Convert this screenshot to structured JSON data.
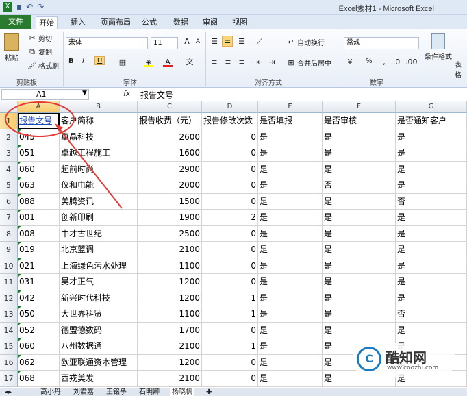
{
  "window": {
    "title": "Excel素材1 - Microsoft Excel"
  },
  "ribbon_tabs": [
    "文件",
    "开始",
    "插入",
    "页面布局",
    "公式",
    "数据",
    "审阅",
    "视图"
  ],
  "clipboard": {
    "paste": "粘贴",
    "cut": "剪切",
    "copy": "复制",
    "format_painter": "格式刷",
    "label": "剪贴板"
  },
  "font": {
    "name": "宋体",
    "size": "11",
    "label": "字体",
    "bold": "B",
    "italic": "I",
    "underline": "U"
  },
  "alignment": {
    "wrap": "自动换行",
    "merge": "合并后居中",
    "label": "对齐方式"
  },
  "number": {
    "format": "常规",
    "percent": "%",
    "label": "数字"
  },
  "styles": {
    "conditional": "条件格式",
    "table": "表格"
  },
  "name_box": "A1",
  "formula_value": "报告文号",
  "fx": "fx",
  "columns": [
    "A",
    "B",
    "C",
    "D",
    "E",
    "F",
    "G"
  ],
  "headers": [
    "报告文号",
    "客户简称",
    "报告收费（元）",
    "报告修改次数",
    "是否填报",
    "是否审核",
    "是否通知客户"
  ],
  "rows": [
    {
      "n": "1"
    },
    {
      "n": "2",
      "a": "045",
      "b": "卓晶科技",
      "c": "2600",
      "d": "0",
      "e": "是",
      "f": "是",
      "g": "是"
    },
    {
      "n": "3",
      "a": "051",
      "b": "卓越工程施工",
      "c": "1600",
      "d": "0",
      "e": "是",
      "f": "是",
      "g": "是"
    },
    {
      "n": "4",
      "a": "060",
      "b": "超前时尚",
      "c": "2900",
      "d": "0",
      "e": "是",
      "f": "是",
      "g": "是"
    },
    {
      "n": "5",
      "a": "063",
      "b": "仪和电能",
      "c": "2000",
      "d": "0",
      "e": "是",
      "f": "否",
      "g": "是"
    },
    {
      "n": "6",
      "a": "088",
      "b": "美腾资讯",
      "c": "1500",
      "d": "0",
      "e": "是",
      "f": "是",
      "g": "否"
    },
    {
      "n": "7",
      "a": "001",
      "b": "创新印刷",
      "c": "1900",
      "d": "2",
      "e": "是",
      "f": "是",
      "g": "是"
    },
    {
      "n": "8",
      "a": "008",
      "b": "中才古世纪",
      "c": "2500",
      "d": "0",
      "e": "是",
      "f": "是",
      "g": "是"
    },
    {
      "n": "9",
      "a": "019",
      "b": "北京蓝调",
      "c": "2100",
      "d": "0",
      "e": "是",
      "f": "是",
      "g": "是"
    },
    {
      "n": "10",
      "a": "021",
      "b": "上海绿色污水处理",
      "c": "1100",
      "d": "0",
      "e": "是",
      "f": "是",
      "g": "是"
    },
    {
      "n": "11",
      "a": "031",
      "b": "昊才正气",
      "c": "1200",
      "d": "0",
      "e": "是",
      "f": "是",
      "g": "是"
    },
    {
      "n": "12",
      "a": "042",
      "b": "新兴时代科技",
      "c": "1200",
      "d": "1",
      "e": "是",
      "f": "是",
      "g": "是"
    },
    {
      "n": "13",
      "a": "050",
      "b": "大世界科贸",
      "c": "1100",
      "d": "1",
      "e": "是",
      "f": "是",
      "g": "否"
    },
    {
      "n": "14",
      "a": "052",
      "b": "德盟德数码",
      "c": "1700",
      "d": "0",
      "e": "是",
      "f": "是",
      "g": "是"
    },
    {
      "n": "15",
      "a": "060",
      "b": "八州数据通",
      "c": "2100",
      "d": "1",
      "e": "是",
      "f": "是",
      "g": "是"
    },
    {
      "n": "16",
      "a": "062",
      "b": "欧亚联通资本管理",
      "c": "1200",
      "d": "0",
      "e": "是",
      "f": "是",
      "g": "是"
    },
    {
      "n": "17",
      "a": "068",
      "b": "西戎美发",
      "c": "2100",
      "d": "0",
      "e": "是",
      "f": "是",
      "g": "是"
    }
  ],
  "sheet_tabs": [
    "高小丹",
    "刘君嘉",
    "王铭争",
    "石明卿",
    "杨晓帆"
  ],
  "watermark": {
    "brand": "酷知网",
    "url": "www.coozhi.com"
  }
}
